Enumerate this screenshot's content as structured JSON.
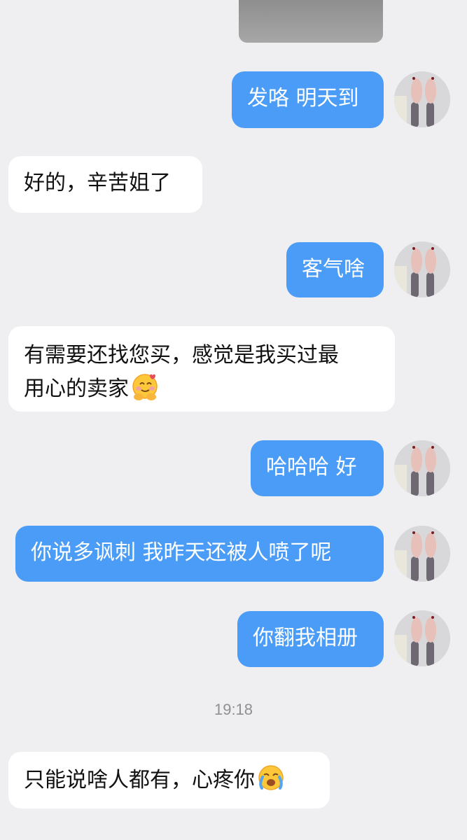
{
  "messages": [
    {
      "id": "m1",
      "side": "sent",
      "text": "发咯 明天到"
    },
    {
      "id": "m2",
      "side": "received",
      "text": "好的，辛苦姐了"
    },
    {
      "id": "m3",
      "side": "sent",
      "text": "客气啥"
    },
    {
      "id": "m4",
      "side": "received",
      "line1": "有需要还找您买，感觉是我买过最",
      "line2": "用心的卖家",
      "emoji": "hugging-face-icon"
    },
    {
      "id": "m5",
      "side": "sent",
      "text": "哈哈哈 好"
    },
    {
      "id": "m6",
      "side": "sent",
      "text": "你说多讽刺 我昨天还被人喷了呢"
    },
    {
      "id": "m7",
      "side": "sent",
      "text": "你翻我相册"
    },
    {
      "id": "m8",
      "side": "received",
      "text": "只能说啥人都有，心疼你",
      "emoji": "crying-face-icon"
    }
  ],
  "timestamp": "19:18",
  "colors": {
    "background": "#efeff1",
    "sent_bubble": "#4a9cf6",
    "received_bubble": "#ffffff"
  }
}
